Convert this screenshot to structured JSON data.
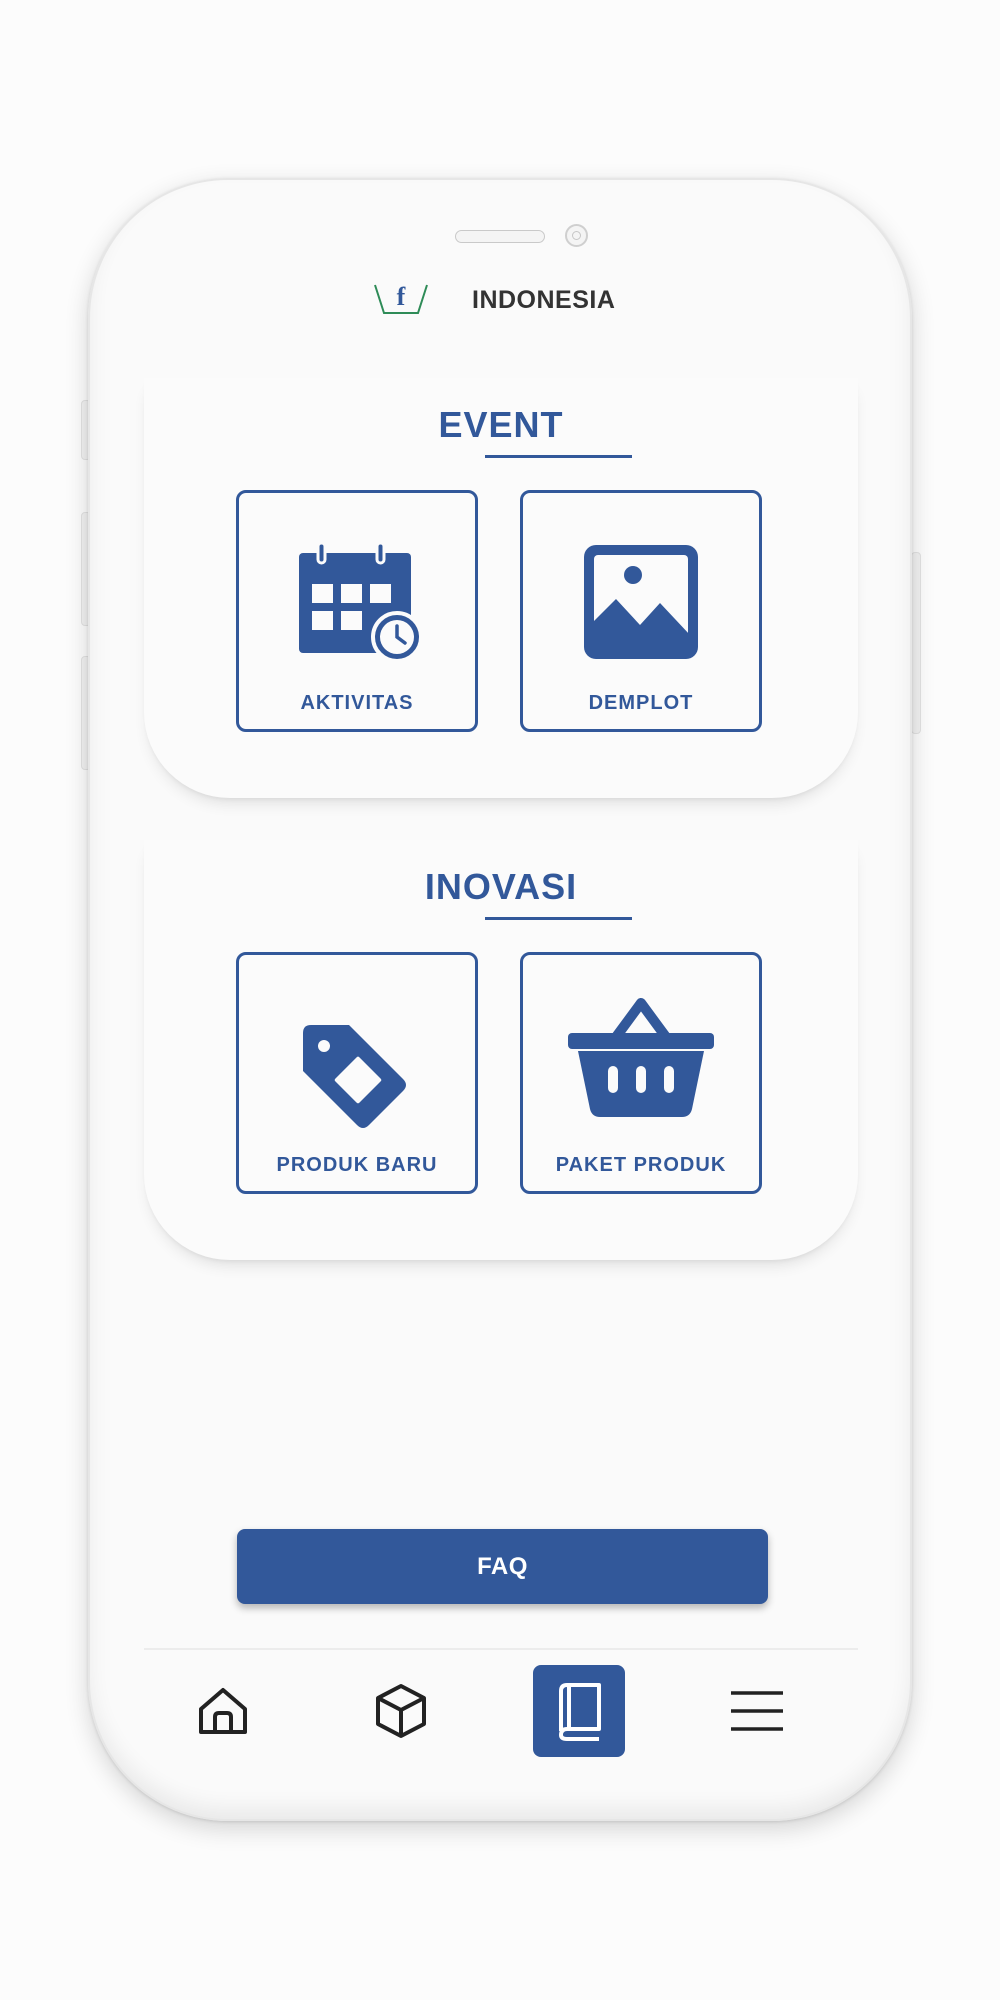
{
  "header": {
    "brand": "INDONESIA",
    "logo_letter": "f"
  },
  "sections": [
    {
      "title": "EVENT",
      "tiles": [
        {
          "label": "AKTIVITAS",
          "icon": "calendar-clock-icon"
        },
        {
          "label": "DEMPLOT",
          "icon": "image-icon"
        }
      ]
    },
    {
      "title": "INOVASI",
      "tiles": [
        {
          "label": "PRODUK BARU",
          "icon": "tag-icon"
        },
        {
          "label": "PAKET PRODUK",
          "icon": "basket-icon"
        }
      ]
    }
  ],
  "faq_button": {
    "label": "FAQ"
  },
  "bottom_nav": {
    "items": [
      {
        "icon": "home-icon",
        "active": false
      },
      {
        "icon": "cube-icon",
        "active": false
      },
      {
        "icon": "book-icon",
        "active": true
      },
      {
        "icon": "menu-icon",
        "active": false
      }
    ]
  },
  "colors": {
    "primary": "#32589a",
    "logo_green": "#2e8b57",
    "background": "#fafafa"
  }
}
